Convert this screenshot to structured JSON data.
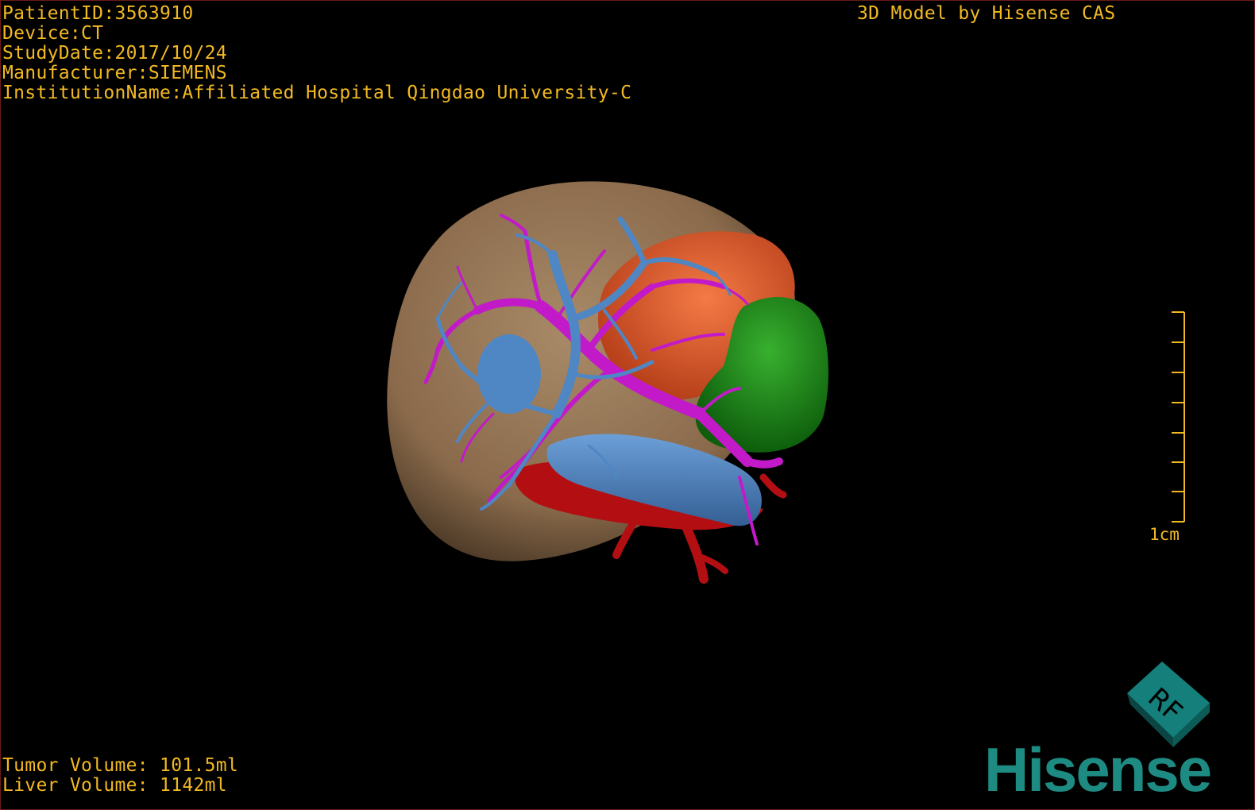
{
  "study_info": {
    "patient_id": "PatientID:3563910",
    "device": "Device:CT",
    "study_date": "StudyDate:2017/10/24",
    "manufacturer": "Manufacturer:SIEMENS",
    "institution": "InstitutionName:Affiliated Hospital Qingdao University-C"
  },
  "brand_caption": "3D Model by Hisense CAS",
  "volumes": {
    "tumor": "Tumor Volume: 101.5ml",
    "liver": "Liver Volume: 1142ml"
  },
  "scale": {
    "label": "1cm",
    "ticks": 8
  },
  "orientation_cube": {
    "face_text": "RF"
  },
  "brand_logo": "Hisense",
  "colors": {
    "overlay_text": "#f2b922",
    "liver": "#8b6b4c",
    "hepatic_vein": "#4f86c4",
    "portal_vein": "#c21ac9",
    "artery": "#b30f12",
    "tumor": "#e0572a",
    "green_structure": "#1f8c1c",
    "logo": "#1e8b82"
  },
  "structures": [
    "liver",
    "portal-vein",
    "hepatic-vein",
    "inferior-vena-cava",
    "hepatic-artery",
    "tumor",
    "green-structure"
  ]
}
